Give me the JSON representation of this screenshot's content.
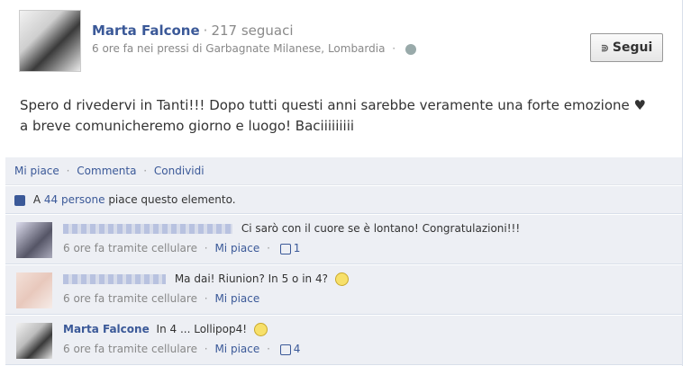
{
  "post": {
    "author": "Marta Falcone",
    "followers": "217 seguaci",
    "time_location": "6 ore fa nei pressi di Garbagnate Milanese, Lombardia",
    "follow_label": "Segui",
    "text_line1": "Spero d rivedervi in Tanti!!! Dopo tutti questi anni sarebbe veramente una forte emozione ♥",
    "text_line2": "a breve comunicheremo giorno e luogo! Baciiiiiiiii"
  },
  "actions": {
    "like": "Mi piace",
    "comment": "Commenta",
    "share": "Condividi",
    "dot": "·"
  },
  "likes": {
    "prefix": "A",
    "count_link": "44 persone",
    "suffix": "piace questo elemento."
  },
  "comments": [
    {
      "name": "",
      "text": "Ci sarò con il cuore se è lontano! Congratulazioni!!!",
      "meta": "6 ore fa tramite cellulare",
      "like": "Mi piace",
      "likes": "1"
    },
    {
      "name": "",
      "text": "Ma dai! Riunion? In 5 o in 4?",
      "meta": "6 ore fa tramite cellulare",
      "like": "Mi piace",
      "likes": ""
    },
    {
      "name": "Marta Falcone",
      "text": "In 4 ... Lollipop4!",
      "meta": "6 ore fa tramite cellulare",
      "like": "Mi piace",
      "likes": "4"
    }
  ]
}
